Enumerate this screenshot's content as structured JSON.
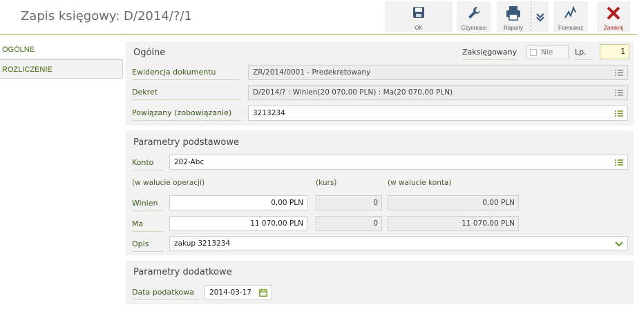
{
  "header": {
    "title": "Zapis księgowy: D/2014/?/1",
    "toolbar": {
      "ok": "OK",
      "czynnosci": "Czynności",
      "raporty": "Raporty",
      "formularz": "Formularz",
      "zamknij": "Zamknij"
    }
  },
  "sidebar": {
    "items": [
      {
        "label": "OGÓLNE"
      },
      {
        "label": "ROZLICZENIE"
      }
    ]
  },
  "ogolne": {
    "title": "Ogólne",
    "zaksiegowany_label": "Zaksięgowany",
    "zaksiegowany_value": "Nie",
    "lp_label": "Lp.",
    "lp_value": "1",
    "ewidencja_label": "Ewidencja dokumentu",
    "ewidencja_value": "ZR/2014/0001 - Predekretowany",
    "dekret_label": "Dekret",
    "dekret_value": "D/2014/? : Winien(20 070,00 PLN) : Ma(20 070,00 PLN)",
    "powiazany_label": "Powiązany (zobowiązanie)",
    "powiazany_value": "3213234"
  },
  "parametry_podstawowe": {
    "title": "Parametry podstawowe",
    "konto_label": "Konto",
    "konto_value": "202-Abc",
    "col_operacji": "(w walucie operacji)",
    "col_kurs": "(kurs)",
    "col_konta": "(w walucie konta)",
    "winien_label": "Winien",
    "winien_operacji": "0,00 PLN",
    "winien_kurs": "0",
    "winien_konta": "0,00 PLN",
    "ma_label": "Ma",
    "ma_operacji": "11 070,00 PLN",
    "ma_kurs": "0",
    "ma_konta": "11 070,00 PLN",
    "opis_label": "Opis",
    "opis_value": "zakup 3213234"
  },
  "parametry_dodatkowe": {
    "title": "Parametry dodatkowe",
    "data_label": "Data podatkowa",
    "data_value": "2014-03-17"
  },
  "colors": {
    "accent": "#8aa33a",
    "label": "#3a5a1a",
    "close": "#b02020",
    "lp_bg": "#fdfbd8"
  }
}
